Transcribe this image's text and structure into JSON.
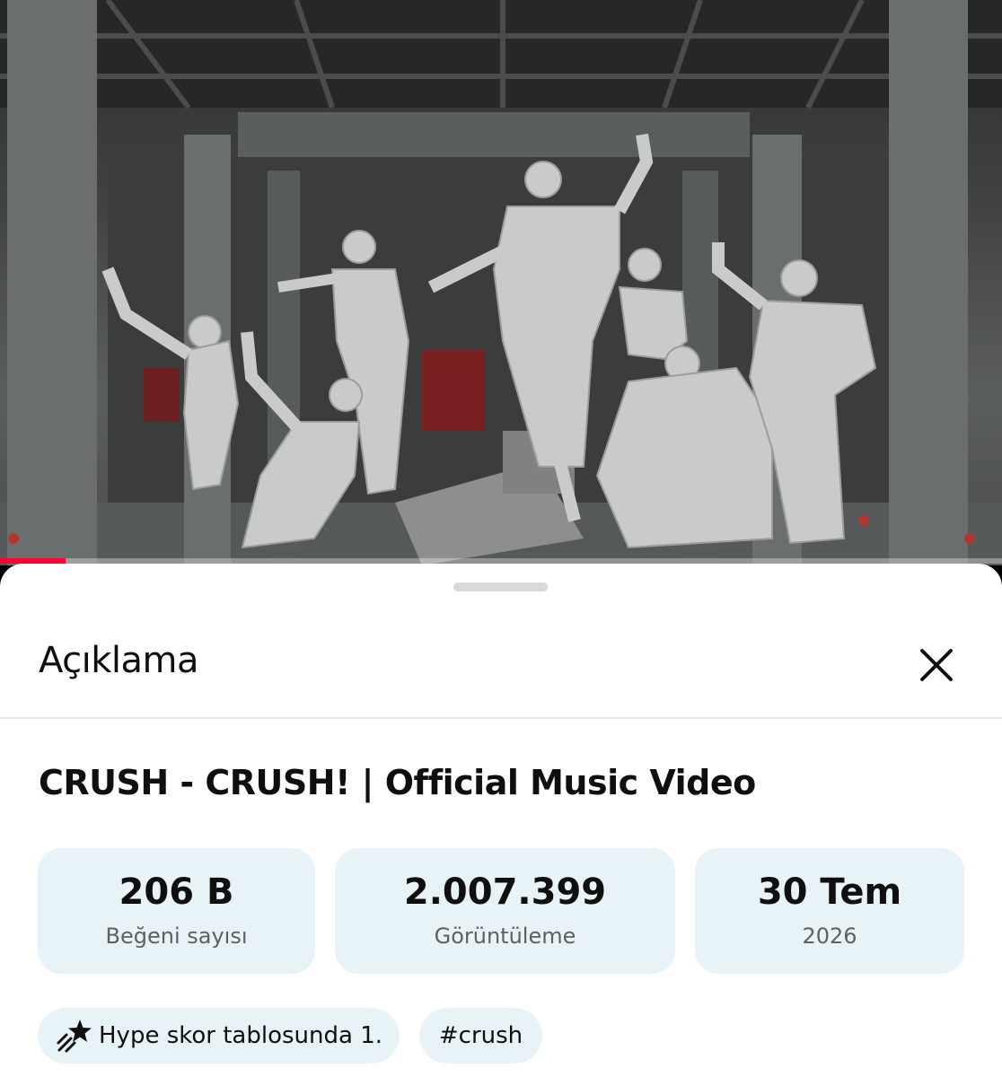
{
  "video": {
    "progress": 0.065,
    "progress_color": "#ff0033"
  },
  "sheet": {
    "title": "Açıklama",
    "close_icon": "close-icon"
  },
  "video_title": "CRUSH - CRUSH! | Official Music Video",
  "stats": {
    "likes": {
      "value": "206 B",
      "label": "Beğeni sayısı"
    },
    "views": {
      "value": "2.007.399",
      "label": "Görüntüleme"
    },
    "date": {
      "value": "30 Tem",
      "label": "2026"
    }
  },
  "chips": {
    "hype": {
      "icon": "hype-star-icon",
      "label": "Hype skor tablosunda 1."
    },
    "hashtag": {
      "label": "#crush"
    }
  },
  "colors": {
    "accent": "#ff0033",
    "stat_bg": "#e8f3f7"
  }
}
